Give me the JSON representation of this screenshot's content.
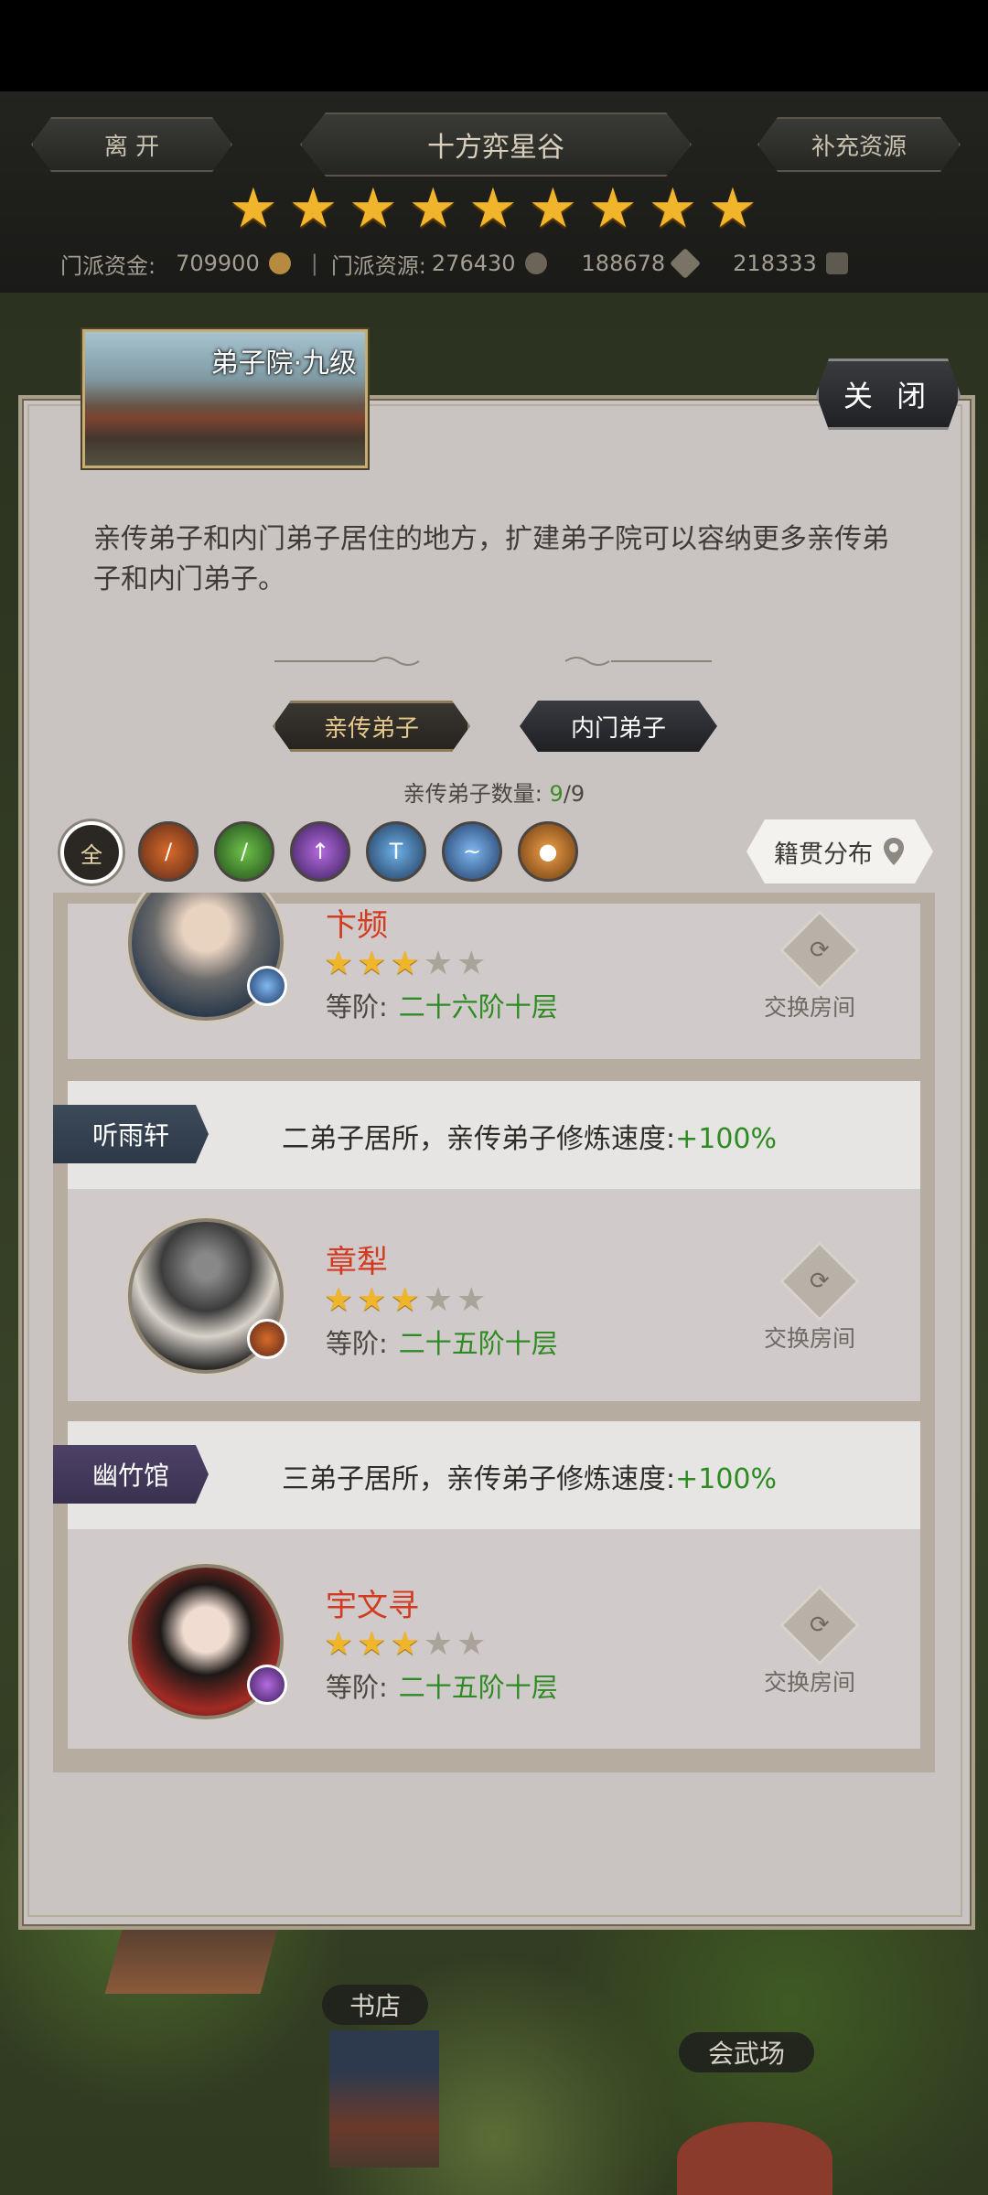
{
  "header": {
    "leave_label": "离 开",
    "title": "十方弈星谷",
    "replenish_label": "补充资源",
    "star_count": 9,
    "funds_label": "门派资金:",
    "funds_value": "709900",
    "resources_label": "门派资源:",
    "resources_value": "276430",
    "res2_value": "188678",
    "res3_value": "218333"
  },
  "panel": {
    "title": "弟子院·九级",
    "close_label": "关 闭",
    "description": "亲传弟子和内门弟子居住的地方，扩建弟子院可以容纳更多亲传弟子和内门弟子。",
    "tabs": [
      "亲传弟子",
      "内门弟子"
    ],
    "count_label": "亲传弟子数量:",
    "count_current": "9",
    "count_sep": "/",
    "count_max": "9",
    "filter_all_label": "全",
    "filter_icons": [
      "sword-class-icon",
      "leaf-class-icon",
      "spear-class-icon",
      "hammer-class-icon",
      "blade-class-icon",
      "fist-class-icon"
    ],
    "origin_button_label": "籍贯分布",
    "origin_icon": "location-pin-icon"
  },
  "rooms": [
    {
      "disciple": {
        "name": "卞频",
        "stars": 3,
        "stars_max": 5,
        "rank_label": "等阶:",
        "rank_value": "二十六阶十层"
      },
      "swap_label": "交换房间"
    },
    {
      "room_name": "听雨轩",
      "room_desc": "二弟子居所，亲传弟子修炼速度:",
      "room_bonus": "+100%",
      "disciple": {
        "name": "章犁",
        "stars": 3,
        "stars_max": 5,
        "rank_label": "等阶:",
        "rank_value": "二十五阶十层"
      },
      "swap_label": "交换房间"
    },
    {
      "room_name": "幽竹馆",
      "room_desc": "三弟子居所，亲传弟子修炼速度:",
      "room_bonus": "+100%",
      "disciple": {
        "name": "宇文寻",
        "stars": 3,
        "stars_max": 5,
        "rank_label": "等阶:",
        "rank_value": "二十五阶十层"
      },
      "swap_label": "交换房间"
    }
  ],
  "map_labels": {
    "bookstore": "书店",
    "arena": "会武场"
  },
  "colors": {
    "accent_green": "#2e8a22",
    "name_red": "#d23b1f",
    "star_gold": "#f0b52a"
  }
}
